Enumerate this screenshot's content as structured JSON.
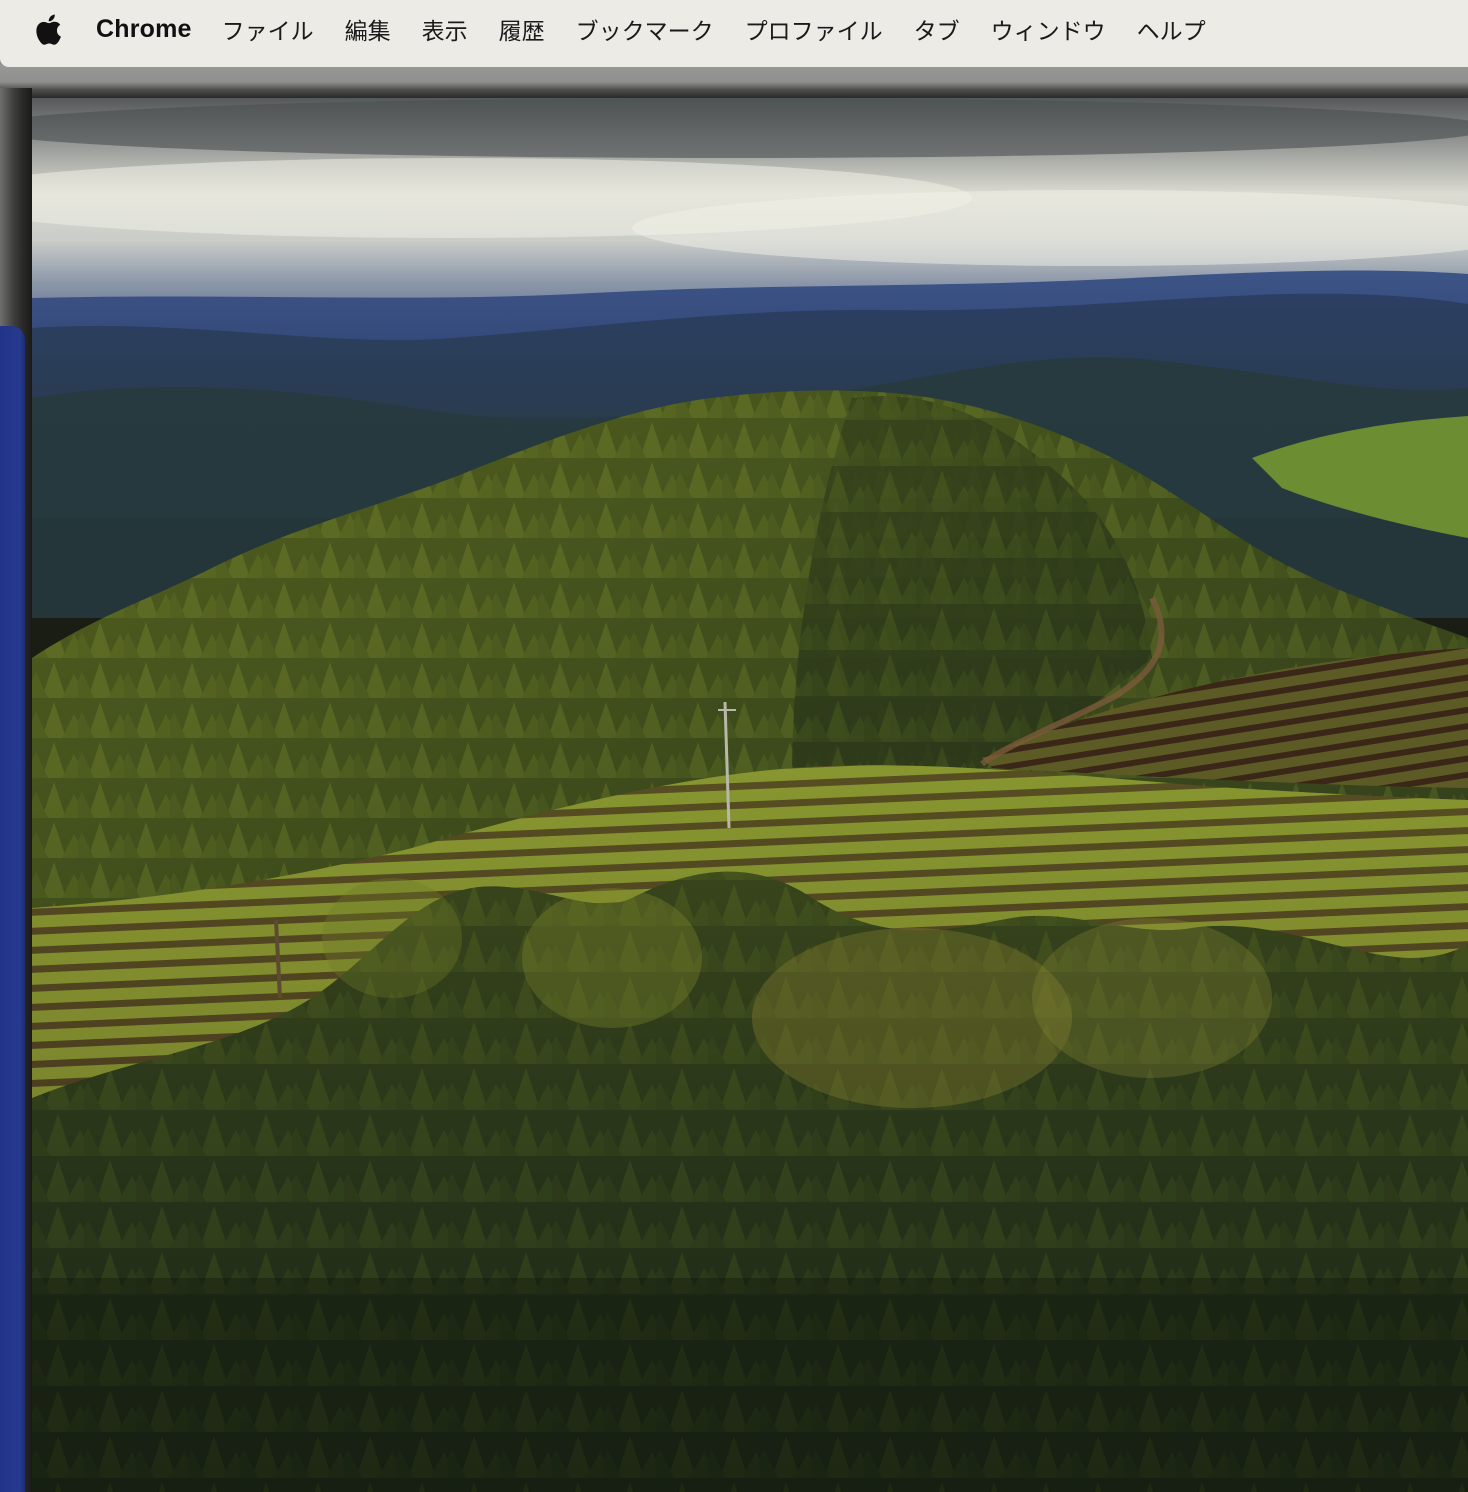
{
  "menubar": {
    "app_name": "Chrome",
    "items": [
      {
        "id": "file",
        "label": "ファイル"
      },
      {
        "id": "edit",
        "label": "編集"
      },
      {
        "id": "view",
        "label": "表示"
      },
      {
        "id": "history",
        "label": "履歴"
      },
      {
        "id": "bookmarks",
        "label": "ブックマーク"
      },
      {
        "id": "profiles",
        "label": "プロファイル"
      },
      {
        "id": "tab",
        "label": "タブ"
      },
      {
        "id": "window",
        "label": "ウィンドウ"
      },
      {
        "id": "help",
        "label": "ヘルプ"
      }
    ]
  },
  "icons": {
    "apple": "apple-logo-icon"
  },
  "colors": {
    "menubar_bg": "#ecebe6",
    "side_panel_blue": "#25398f"
  }
}
